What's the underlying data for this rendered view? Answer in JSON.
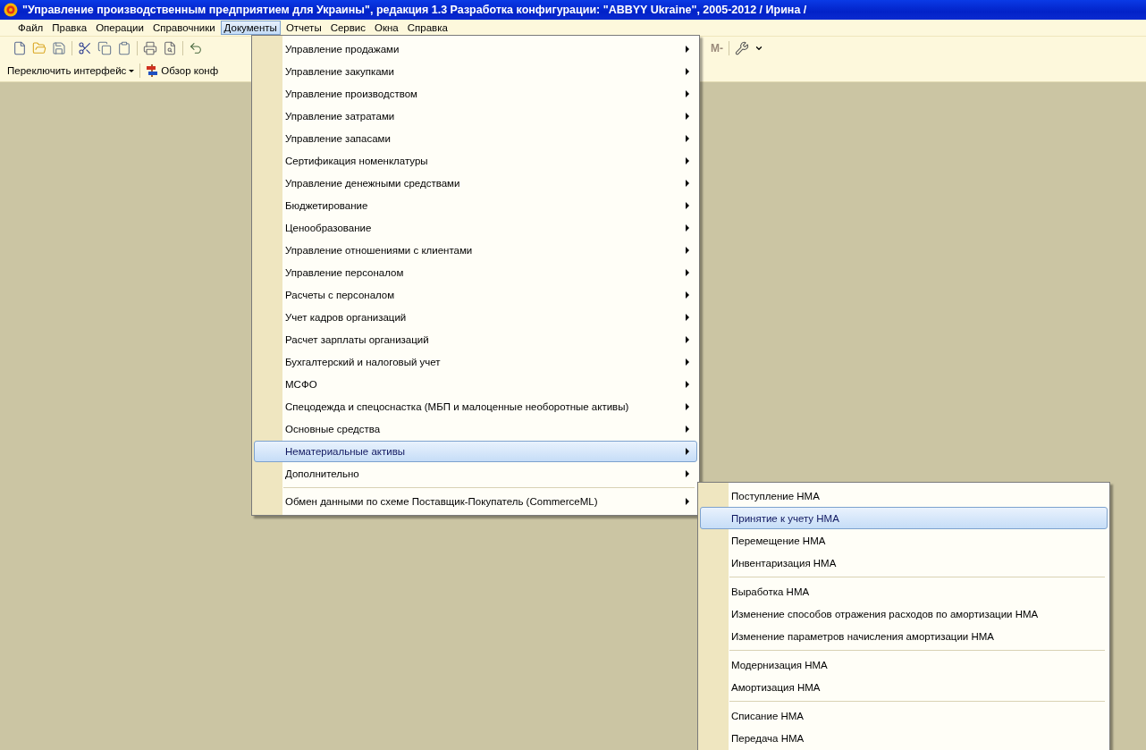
{
  "window": {
    "title": "\"Управление производственным предприятием для Украины\", редакция 1.3 Разработка конфигурации: \"ABBYY Ukraine\", 2005-2012 / Ирина /"
  },
  "menubar": [
    {
      "label": "Файл",
      "selected": false
    },
    {
      "label": "Правка",
      "selected": false
    },
    {
      "label": "Операции",
      "selected": false
    },
    {
      "label": "Справочники",
      "selected": false
    },
    {
      "label": "Документы",
      "selected": true
    },
    {
      "label": "Отчеты",
      "selected": false
    },
    {
      "label": "Сервис",
      "selected": false
    },
    {
      "label": "Окна",
      "selected": false
    },
    {
      "label": "Справка",
      "selected": false
    }
  ],
  "toolbar": {
    "memory_button": "М-"
  },
  "toolbar2": [
    {
      "kind": "dropdown",
      "label": "Переключить интерфейс"
    },
    {
      "kind": "link",
      "label": "Обзор конф"
    }
  ],
  "menu": {
    "groups": [
      [
        {
          "label": "Управление продажами",
          "selected": false
        },
        {
          "label": "Управление закупками",
          "selected": false
        },
        {
          "label": "Управление производством",
          "selected": false
        },
        {
          "label": "Управление затратами",
          "selected": false
        },
        {
          "label": "Управление запасами",
          "selected": false
        },
        {
          "label": "Сертификация номенклатуры",
          "selected": false
        },
        {
          "label": "Управление денежными средствами",
          "selected": false
        },
        {
          "label": "Бюджетирование",
          "selected": false
        },
        {
          "label": "Ценообразование",
          "selected": false
        },
        {
          "label": "Управление отношениями с клиентами",
          "selected": false
        },
        {
          "label": "Управление персоналом",
          "selected": false
        },
        {
          "label": "Расчеты с персоналом",
          "selected": false
        },
        {
          "label": "Учет кадров организаций",
          "selected": false
        },
        {
          "label": "Расчет зарплаты организаций",
          "selected": false
        },
        {
          "label": "Бухгалтерский и налоговый учет",
          "selected": false
        },
        {
          "label": "МСФО",
          "selected": false
        },
        {
          "label": "Спецодежда и спецоснастка (МБП и малоценные необоротные активы)",
          "selected": false
        },
        {
          "label": "Основные средства",
          "selected": false
        },
        {
          "label": "Нематериальные активы",
          "selected": true
        },
        {
          "label": "Дополнительно",
          "selected": false
        }
      ],
      [
        {
          "label": "Обмен данными по схеме Поставщик-Покупатель (CommerceML)",
          "selected": false
        }
      ]
    ]
  },
  "submenu": {
    "groups": [
      [
        {
          "label": "Поступление НМА",
          "selected": false
        },
        {
          "label": "Принятие к учету НМА",
          "selected": true
        },
        {
          "label": "Перемещение НМА",
          "selected": false
        },
        {
          "label": "Инвентаризация НМА",
          "selected": false
        }
      ],
      [
        {
          "label": "Выработка НМА",
          "selected": false
        },
        {
          "label": "Изменение способов отражения расходов по амортизации НМА",
          "selected": false
        },
        {
          "label": "Изменение параметров начисления амортизации НМА",
          "selected": false
        }
      ],
      [
        {
          "label": "Модернизация НМА",
          "selected": false
        },
        {
          "label": "Амортизация НМА",
          "selected": false
        }
      ],
      [
        {
          "label": "Списание НМА",
          "selected": false
        },
        {
          "label": "Передача НМА",
          "selected": false
        }
      ]
    ]
  }
}
